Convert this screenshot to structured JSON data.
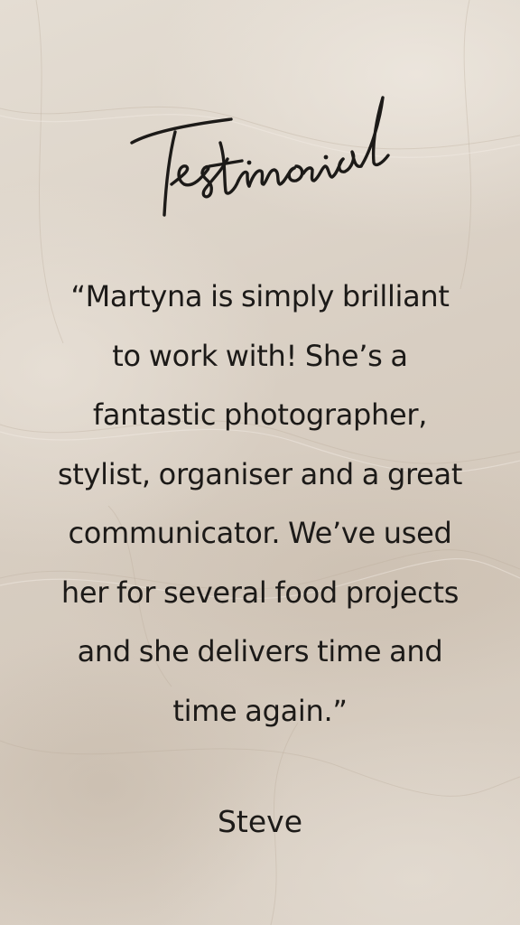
{
  "card": {
    "title": "Testimonial",
    "quote_lines": [
      "“Martyna is simply brilliant",
      "to work with! She’s a",
      "fantastic photographer,",
      "stylist, organiser and a great",
      "communicator. We’ve used",
      "her for several food projects",
      "and she delivers time and",
      "time again.”"
    ],
    "author": "Steve"
  },
  "colors": {
    "background": "#d9d0c5",
    "text": "#1c1a18"
  }
}
